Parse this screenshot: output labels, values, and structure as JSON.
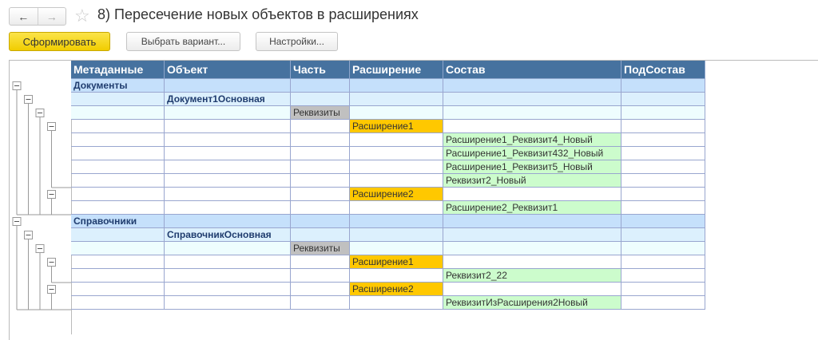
{
  "nav": {
    "back": "←",
    "forward": "→"
  },
  "title": "8) Пересечение новых объектов в расширениях",
  "toolbar": {
    "generate": "Сформировать",
    "variant": "Выбрать вариант...",
    "settings": "Настройки..."
  },
  "colors": {
    "header": "#46729f",
    "level1": "#c5e0fb",
    "level2": "#dcf0fd",
    "level3": "#eefdfe",
    "part": "#c0c0c0",
    "extension": "#ffc800",
    "content": "#ccfccc"
  },
  "columns": [
    "Метаданные",
    "Объект",
    "Часть",
    "Расширение",
    "Состав",
    "ПодСостав"
  ],
  "rows": [
    {
      "toggle": 1,
      "bg": "level1",
      "cells": [
        "Документы",
        "",
        "",
        "",
        "",
        ""
      ]
    },
    {
      "toggle": 2,
      "bg": "level2",
      "cells": [
        "",
        "Документ1Основная",
        "",
        "",
        "",
        ""
      ]
    },
    {
      "toggle": 3,
      "bg": "level3",
      "cells": [
        "",
        "",
        "Реквизиты",
        "",
        "",
        ""
      ]
    },
    {
      "toggle": 4,
      "bg": "",
      "cells": [
        "",
        "",
        "",
        "Расширение1",
        "",
        ""
      ]
    },
    {
      "toggle": 0,
      "bg": "",
      "cells": [
        "",
        "",
        "",
        "",
        "Расширение1_Реквизит4_Новый",
        ""
      ]
    },
    {
      "toggle": 0,
      "bg": "",
      "cells": [
        "",
        "",
        "",
        "",
        "Расширение1_Реквизит432_Новый",
        ""
      ]
    },
    {
      "toggle": 0,
      "bg": "",
      "cells": [
        "",
        "",
        "",
        "",
        "Расширение1_Реквизит5_Новый",
        ""
      ]
    },
    {
      "toggle": 0,
      "bg": "",
      "cells": [
        "",
        "",
        "",
        "",
        "Реквизит2_Новый",
        ""
      ]
    },
    {
      "toggle": 4,
      "bg": "",
      "cells": [
        "",
        "",
        "",
        "Расширение2",
        "",
        ""
      ]
    },
    {
      "toggle": 0,
      "bg": "",
      "cells": [
        "",
        "",
        "",
        "",
        "Расширение2_Реквизит1",
        ""
      ]
    },
    {
      "toggle": 1,
      "bg": "level1",
      "cells": [
        "Справочники",
        "",
        "",
        "",
        "",
        ""
      ]
    },
    {
      "toggle": 2,
      "bg": "level2",
      "cells": [
        "",
        "СправочникОсновная",
        "",
        "",
        "",
        ""
      ]
    },
    {
      "toggle": 3,
      "bg": "level3",
      "cells": [
        "",
        "",
        "Реквизиты",
        "",
        "",
        ""
      ]
    },
    {
      "toggle": 4,
      "bg": "",
      "cells": [
        "",
        "",
        "",
        "Расширение1",
        "",
        ""
      ]
    },
    {
      "toggle": 0,
      "bg": "",
      "cells": [
        "",
        "",
        "",
        "",
        "Реквизит2_22",
        ""
      ]
    },
    {
      "toggle": 4,
      "bg": "",
      "cells": [
        "",
        "",
        "",
        "Расширение2",
        "",
        ""
      ]
    },
    {
      "toggle": 0,
      "bg": "",
      "cells": [
        "",
        "",
        "",
        "",
        "РеквизитИзРасширения2Новый",
        ""
      ]
    }
  ]
}
